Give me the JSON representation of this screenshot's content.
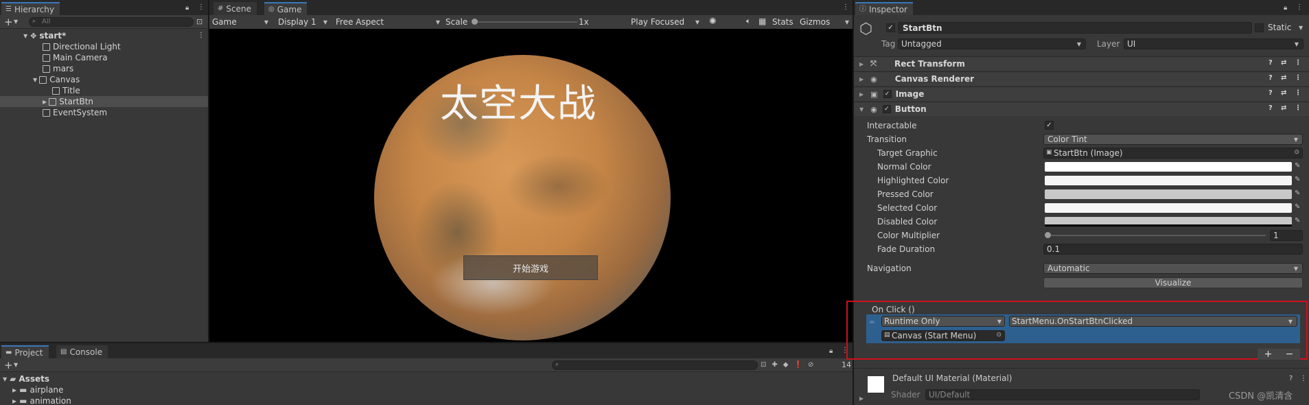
{
  "hierarchy": {
    "tab_label": "Hierarchy",
    "search_placeholder": "All",
    "items": [
      {
        "label": "start*"
      },
      {
        "label": "Directional Light"
      },
      {
        "label": "Main Camera"
      },
      {
        "label": "mars"
      },
      {
        "label": "Canvas"
      },
      {
        "label": "Title"
      },
      {
        "label": "StartBtn"
      },
      {
        "label": "EventSystem"
      }
    ]
  },
  "scene_tabs": [
    {
      "label": "Scene"
    },
    {
      "label": "Game"
    }
  ],
  "game_toolbar": {
    "mode": "Game",
    "display": "Display 1",
    "aspect": "Free Aspect",
    "scale_label": "Scale",
    "scale_value": "1x",
    "play_mode": "Play Focused",
    "stats": "Stats",
    "gizmos": "Gizmos"
  },
  "game_view": {
    "title_text": "太空大战",
    "button_text": "开始游戏"
  },
  "inspector": {
    "tab_label": "Inspector",
    "object_name": "StartBtn",
    "static_label": "Static",
    "tag_label": "Tag",
    "tag_value": "Untagged",
    "layer_label": "Layer",
    "layer_value": "UI",
    "components": [
      {
        "label": "Rect Transform"
      },
      {
        "label": "Canvas Renderer"
      },
      {
        "label": "Image"
      },
      {
        "label": "Button"
      }
    ],
    "button": {
      "interactable_label": "Interactable",
      "transition_label": "Transition",
      "transition_value": "Color Tint",
      "target_graphic_label": "Target Graphic",
      "target_graphic_value": "StartBtn (Image)",
      "normal_color_label": "Normal Color",
      "highlighted_color_label": "Highlighted Color",
      "pressed_color_label": "Pressed Color",
      "selected_color_label": "Selected Color",
      "disabled_color_label": "Disabled Color",
      "color_multiplier_label": "Color Multiplier",
      "color_multiplier_value": "1",
      "fade_duration_label": "Fade Duration",
      "fade_duration_value": "0.1",
      "navigation_label": "Navigation",
      "navigation_value": "Automatic",
      "visualize_label": "Visualize"
    },
    "on_click": {
      "header": "On Click ()",
      "runtime": "Runtime Only",
      "function": "StartMenu.OnStartBtnClicked",
      "object": "Canvas (Start Menu)",
      "add": "+",
      "remove": "−"
    },
    "material": {
      "name": "Default UI Material (Material)",
      "shader_label": "Shader",
      "shader_value": "UI/Default"
    }
  },
  "project": {
    "tabs": [
      {
        "label": "Project"
      },
      {
        "label": "Console"
      }
    ],
    "hidden_count": "14",
    "tree": [
      {
        "label": "Assets"
      },
      {
        "label": "airplane"
      },
      {
        "label": "animation"
      }
    ]
  },
  "watermark": "CSDN @凯清含",
  "colors": {
    "highlight_frame": "#d0101a",
    "selected_row": "#2b5d8a",
    "onclick_body": "#2e608f",
    "accent": "#3a79bb"
  }
}
